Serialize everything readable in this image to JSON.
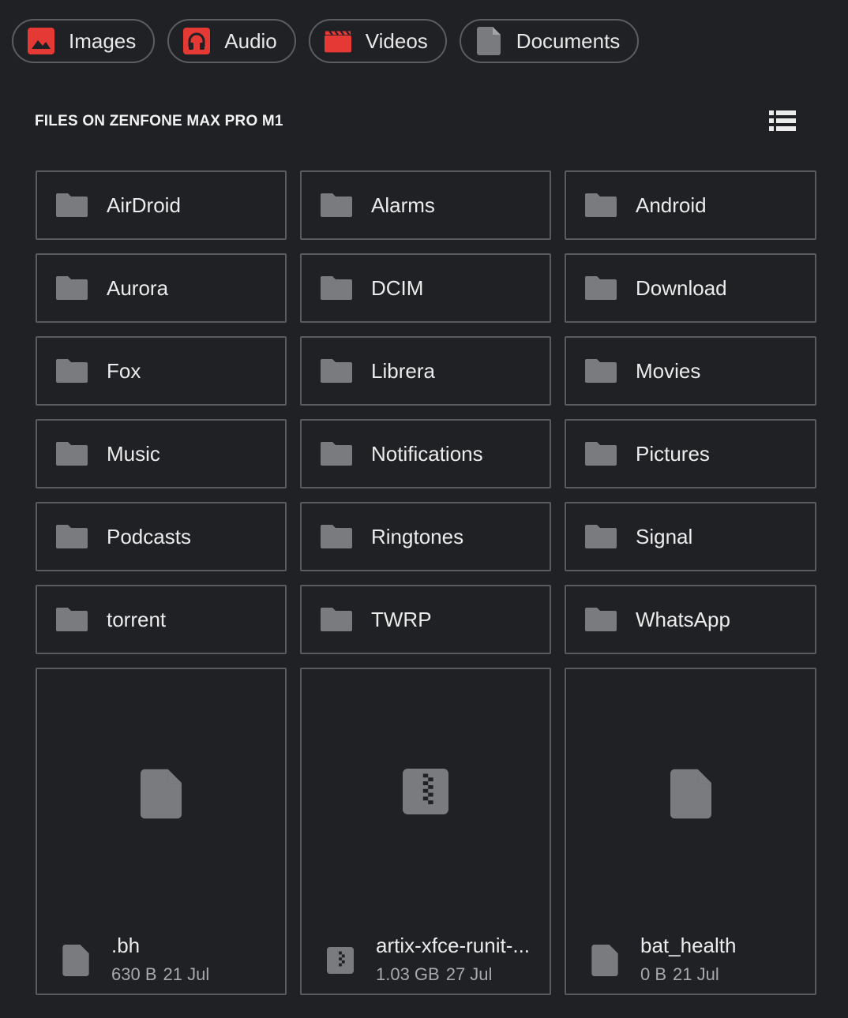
{
  "colors": {
    "background": "#202125",
    "accent": "#e53935",
    "icon_grey": "#7a7b7f"
  },
  "categories": [
    {
      "label": "Images",
      "icon": "image-icon"
    },
    {
      "label": "Audio",
      "icon": "headphones-icon"
    },
    {
      "label": "Videos",
      "icon": "clapperboard-icon"
    },
    {
      "label": "Documents",
      "icon": "document-icon"
    }
  ],
  "section": {
    "title": "FILES ON ZENFONE MAX PRO M1",
    "view_toggle_icon": "list-view-icon"
  },
  "folders": [
    "AirDroid",
    "Alarms",
    "Android",
    "Aurora",
    "DCIM",
    "Download",
    "Fox",
    "Librera",
    "Movies",
    "Music",
    "Notifications",
    "Pictures",
    "Podcasts",
    "Ringtones",
    "Signal",
    "torrent",
    "TWRP",
    "WhatsApp"
  ],
  "files": [
    {
      "name": ".bh",
      "size": "630 B",
      "date": "21 Jul",
      "icon": "file-icon"
    },
    {
      "name": "artix-xfce-runit-...",
      "size": "1.03 GB",
      "date": "27 Jul",
      "icon": "archive-icon"
    },
    {
      "name": "bat_health",
      "size": "0 B",
      "date": "21 Jul",
      "icon": "file-icon"
    }
  ]
}
